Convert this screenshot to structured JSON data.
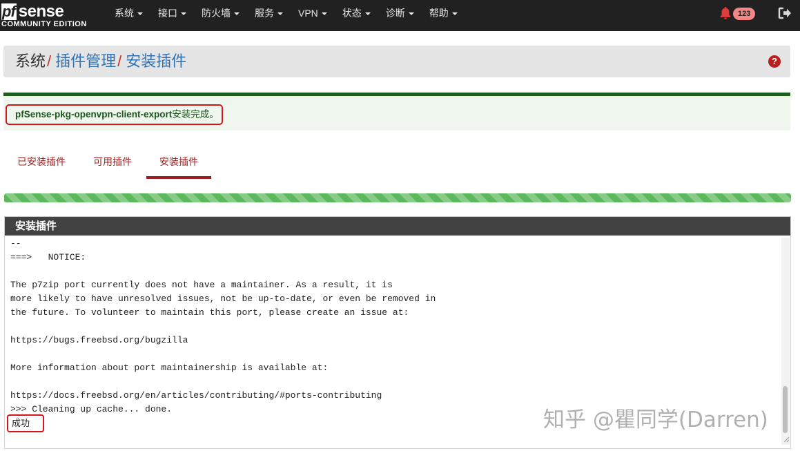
{
  "brand": {
    "logo_mark": "pf",
    "logo_word": "sense",
    "edition": "COMMUNITY EDITION"
  },
  "nav": {
    "items": [
      {
        "label": "系统"
      },
      {
        "label": "接口"
      },
      {
        "label": "防火墙"
      },
      {
        "label": "服务"
      },
      {
        "label": "VPN"
      },
      {
        "label": "状态"
      },
      {
        "label": "诊断"
      },
      {
        "label": "帮助"
      }
    ],
    "notification_count": "123"
  },
  "breadcrumb": {
    "root": "系统",
    "separator": "/",
    "level1": "插件管理",
    "level2": "安装插件",
    "help_glyph": "?"
  },
  "alert": {
    "package": "pfSense-pkg-openvpn-client-export",
    "message": "安装完成。"
  },
  "tabs": [
    {
      "label": "已安装插件",
      "active": false
    },
    {
      "label": "可用插件",
      "active": false
    },
    {
      "label": "安装插件",
      "active": true
    }
  ],
  "progress": {
    "value_percent": 100,
    "color": "#5cb85c"
  },
  "panel": {
    "title": "安装插件"
  },
  "log": {
    "lines": [
      "--",
      "===>   NOTICE:",
      "",
      "The p7zip port currently does not have a maintainer. As a result, it is",
      "more likely to have unresolved issues, not be up-to-date, or even be removed in",
      "the future. To volunteer to maintain this port, please create an issue at:",
      "",
      "https://bugs.freebsd.org/bugzilla",
      "",
      "More information about port maintainership is available at:",
      "",
      "https://docs.freebsd.org/en/articles/contributing/#ports-contributing",
      ">>> Cleaning up cache... done."
    ],
    "result": "成功"
  },
  "watermark": "知乎 @瞿同学(Darren)",
  "colors": {
    "navbar": "#212121",
    "accent_red": "#9c1f1f",
    "link_blue": "#3172b4",
    "success_green": "#1d5e1d",
    "highlight_red": "#d3161b"
  }
}
